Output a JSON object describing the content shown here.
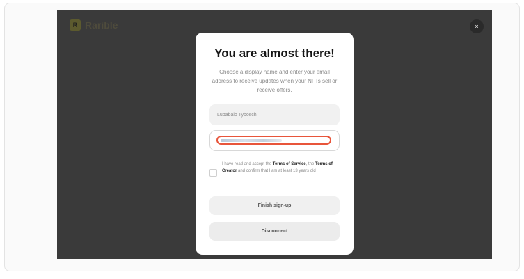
{
  "header": {
    "brand_name": "Rarible",
    "logo_initials": "R",
    "close_symbol": "×"
  },
  "modal": {
    "title": "You are almost there!",
    "subtitle": "Choose a display name and enter your email address to receive updates when your NFTs sell or receive offers.",
    "display_name_value": "Lubabalo Tybosch",
    "email_value_redacted": true,
    "terms": {
      "prefix": "I have read and accept the ",
      "terms_of_service": "Terms of Service",
      "middle": ", the ",
      "terms_of_creator": "Terms of Creator",
      "suffix": " and confirm that I am at least 13 years old",
      "checked": false
    },
    "finish_label": "Finish sign-up",
    "disconnect_label": "Disconnect"
  },
  "colors": {
    "backdrop": "#3a3a3a",
    "accent_focus": "#e8553b",
    "modal_bg": "#ffffff"
  },
  "icons": {
    "close": "close-icon",
    "logo": "rarible-logo-icon"
  }
}
